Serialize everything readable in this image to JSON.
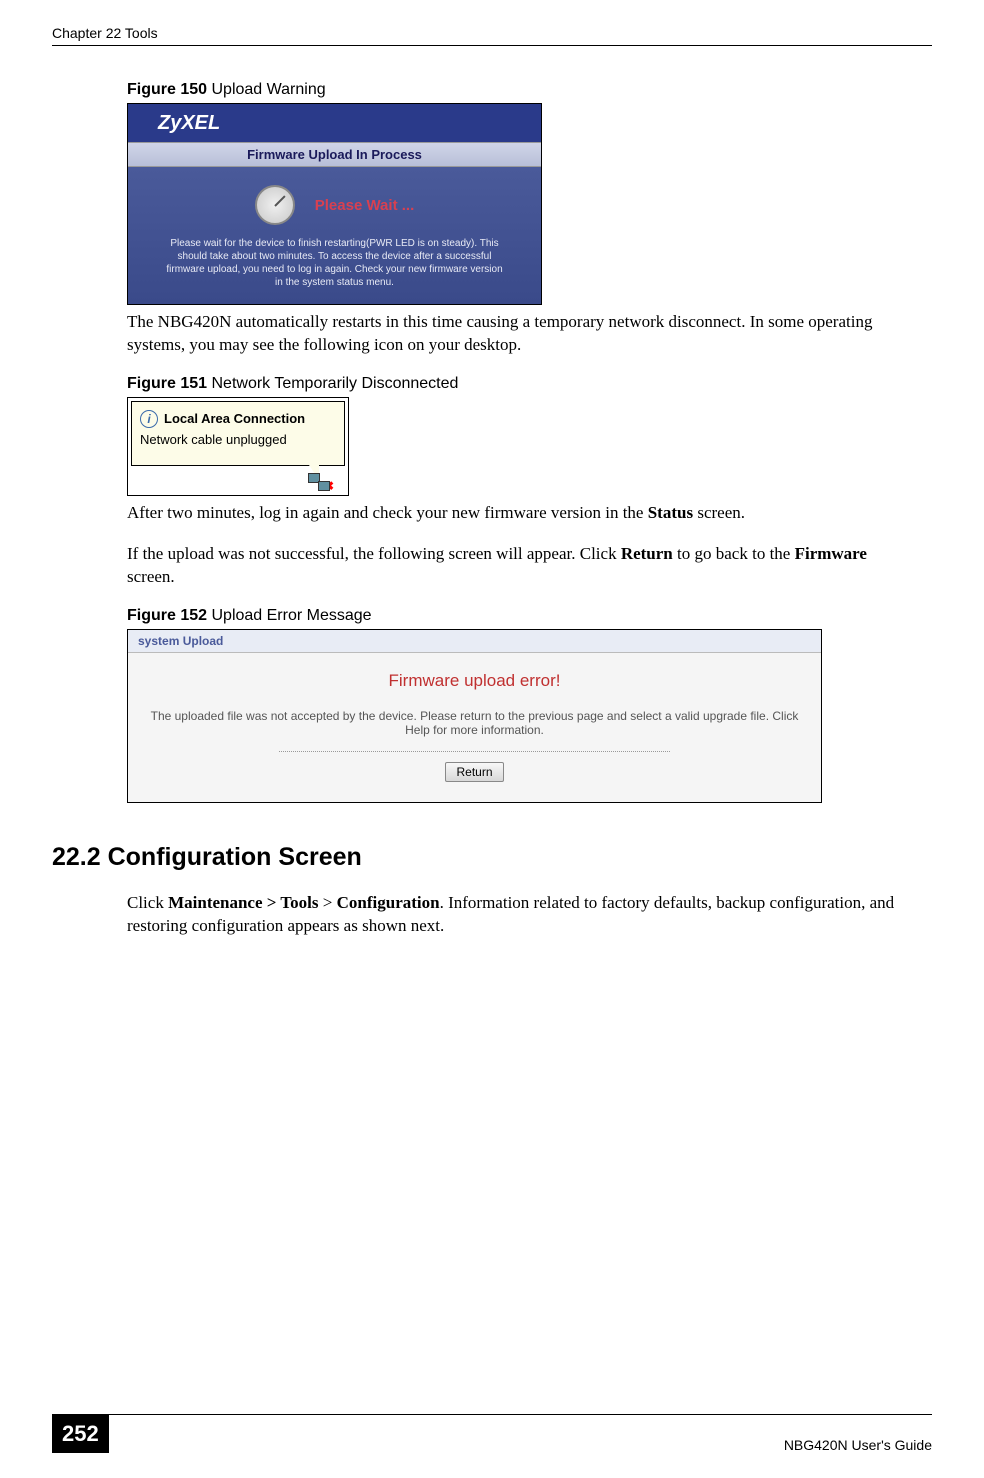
{
  "header": {
    "chapter": "Chapter 22 Tools"
  },
  "fig150": {
    "label_bold": "Figure 150   ",
    "label_text": "Upload Warning",
    "logo": "ZyXEL",
    "subheader": "Firmware Upload In Process",
    "wait": "Please Wait ...",
    "msg": "Please wait for the device to finish restarting(PWR LED is on steady). This should take about two minutes. To access the device after a successful firmware upload, you need to log in again. Check your new firmware version in the system status menu."
  },
  "para1": "The NBG420N automatically restarts in this time causing a temporary network disconnect. In some operating systems, you may see the following icon on your desktop.",
  "fig151": {
    "label_bold": "Figure 151   ",
    "label_text": "Network Temporarily Disconnected",
    "title": "Local Area Connection",
    "sub": "Network cable unplugged"
  },
  "para2_part1": "After two minutes, log in again and check your new firmware version in the ",
  "para2_bold1": "Status",
  "para2_part2": " screen.",
  "para3_part1": "If the upload was not successful, the following screen will appear. Click ",
  "para3_bold1": "Return",
  "para3_part2": " to go back to the ",
  "para3_bold2": "Firmware",
  "para3_part3": " screen.",
  "fig152": {
    "label_bold": "Figure 152   ",
    "label_text": "Upload Error Message",
    "header": "system Upload",
    "error": "Firmware upload error!",
    "msg": "The uploaded file was not accepted by the device. Please return to the previous page and select a valid upgrade file. Click Help for more information.",
    "btn": "Return"
  },
  "section": {
    "heading": "22.2  Configuration Screen",
    "para_part1": "Click ",
    "para_bold1": "Maintenance > Tools",
    "para_part2": " > ",
    "para_bold2": "Configuration",
    "para_part3": ". Information related to factory defaults, backup configuration, and restoring configuration appears as shown next."
  },
  "footer": {
    "page": "252",
    "guide": "NBG420N User's Guide"
  }
}
